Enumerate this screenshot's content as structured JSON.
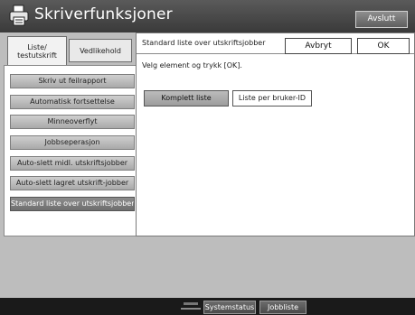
{
  "title": "Skriverfunksjoner",
  "exit_label": "Avslutt",
  "tabs": [
    {
      "label": "Liste/\ntestutskrift"
    },
    {
      "label": "Vedlikehold"
    }
  ],
  "menu": [
    {
      "label": "Skriv ut feilrapport"
    },
    {
      "label": "Automatisk fortsettelse"
    },
    {
      "label": "Minneoverflyt"
    },
    {
      "label": "Jobbseperasjon"
    },
    {
      "label": "Auto-slett midl. utskriftsjobber"
    },
    {
      "label": "Auto-slett lagret utskrift-jobber"
    },
    {
      "label": "Standard liste over utskriftsjobber"
    }
  ],
  "panel": {
    "title": "Standard liste over utskriftsjobber",
    "cancel_label": "Avbryt",
    "ok_label": "OK",
    "instruction": "Velg element og trykk [OK].",
    "options": [
      {
        "label": "Komplett liste",
        "selected": true
      },
      {
        "label": "Liste per bruker-ID",
        "selected": false
      }
    ]
  },
  "statusbar": {
    "system_status_label": "Systemstatus",
    "job_list_label": "Jobbliste"
  }
}
